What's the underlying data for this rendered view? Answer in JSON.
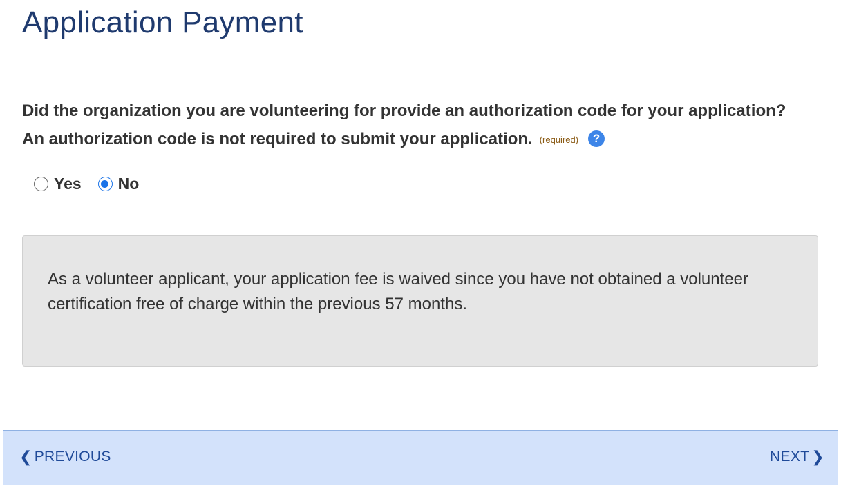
{
  "page": {
    "title": "Application Payment"
  },
  "question": {
    "text": "Did the organization you are volunteering for provide an authorization code for your application? An authorization code is not required to submit your application.",
    "required_label": "(required)",
    "help_icon": "question-circle-icon",
    "help_glyph": "?"
  },
  "radio": {
    "options": [
      {
        "label": "Yes",
        "checked": false
      },
      {
        "label": "No",
        "checked": true
      }
    ]
  },
  "info": {
    "text": "As a volunteer applicant, your application fee is waived since you have not obtained a volunteer certification free of charge within the previous 57 months."
  },
  "footer": {
    "previous_label": "PREVIOUS",
    "next_label": "NEXT",
    "previous_icon": "chevron-left-icon",
    "next_icon": "chevron-right-icon"
  },
  "colors": {
    "title": "#1f3a6e",
    "accent": "#1a73e8",
    "help_icon": "#3d85e8",
    "info_background": "#e6e6e6",
    "footer_background": "#d3e2fb",
    "nav_text": "#1f4a99",
    "required": "#8a5a14"
  }
}
